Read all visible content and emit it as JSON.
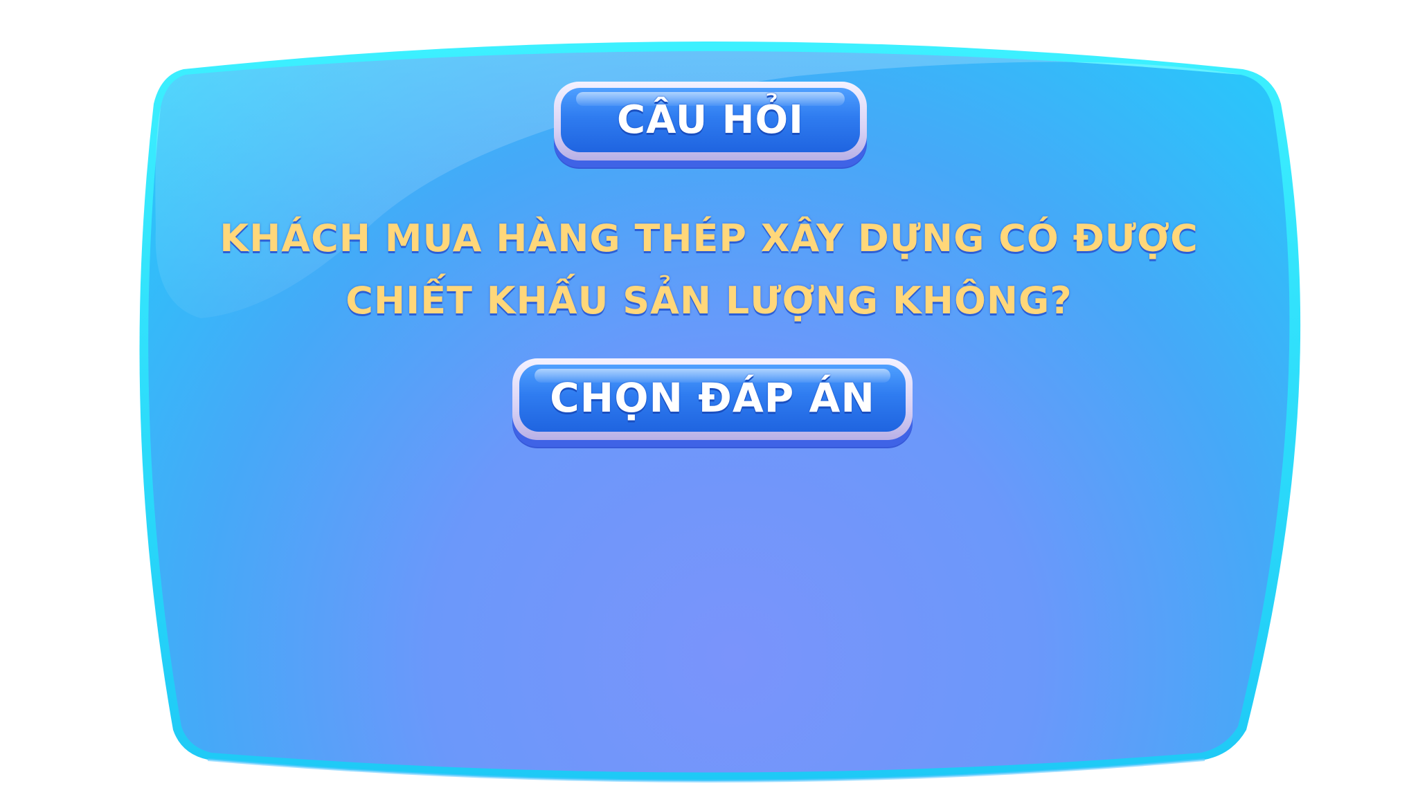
{
  "question_panel": {
    "header_label": "CÂU HỎI",
    "question_line_1": "KHÁCH MUA HÀNG THÉP XÂY DỰNG CÓ ĐƯỢC",
    "question_line_2": "CHIẾT KHẤU SẢN LƯỢNG KHÔNG?",
    "choose_answer_label": "CHỌN ĐÁP ÁN"
  },
  "colors": {
    "panel_top": "#22d8fb",
    "panel_center": "#7a94fb",
    "panel_edge": "#3ab0f7",
    "question_text": "#ffd77a",
    "button_blue": "#2f7cf0",
    "button_rim": "#e9e5ff"
  }
}
